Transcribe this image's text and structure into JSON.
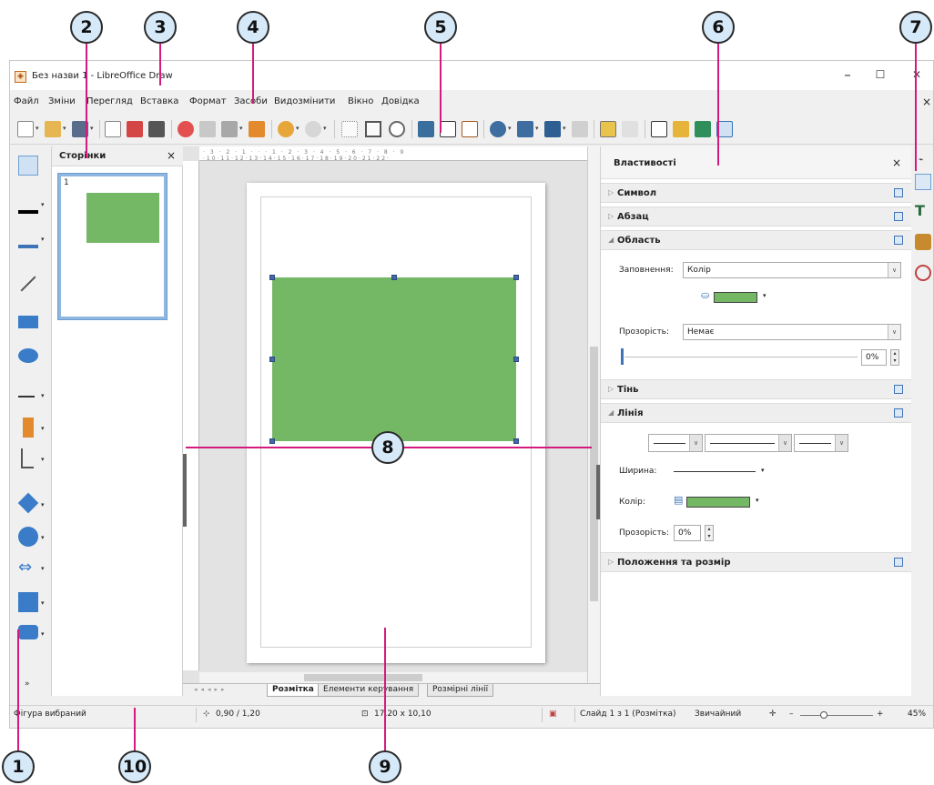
{
  "window": {
    "title": "Без назви 1 - LibreOffice Draw",
    "minimize": "–",
    "maximize": "☐",
    "close": "✕"
  },
  "menu": {
    "items": [
      "Файл",
      "Зміни",
      "Перегляд",
      "Вставка",
      "Формат",
      "Засоби",
      "Видозмінити",
      "Вікно",
      "Довідка"
    ],
    "close": "×"
  },
  "pages_panel": {
    "title": "Сторінки",
    "close": "×",
    "page_number": "1"
  },
  "properties": {
    "title": "Властивості",
    "close": "×",
    "sections": {
      "symbol": "Символ",
      "paragraph": "Абзац",
      "area": "Область",
      "shadow": "Тінь",
      "line": "Лінія",
      "position": "Положення та розмір"
    },
    "fill_label": "Заповнення:",
    "fill_value": "Колір",
    "transparency_label": "Прозорість:",
    "transparency_value": "Немає",
    "transparency_percent": "0%",
    "width_label": "Ширина:",
    "color_label": "Колір:",
    "line_transparency_label": "Прозорість:",
    "line_transparency_value": "0%"
  },
  "tabs": [
    "Розмітка",
    "Елементи керування",
    "Розмірні лінії"
  ],
  "status": {
    "selection": "Фігура вибраний",
    "position": "0,90 / 1,20",
    "size": "17,20 x 10,10",
    "slide": "Слайд 1 з 1 (Розмітка)",
    "master": "Звичайний",
    "zoom": "45%"
  },
  "callouts": [
    "1",
    "2",
    "3",
    "4",
    "5",
    "6",
    "7",
    "8",
    "9",
    "10"
  ],
  "colors": {
    "shape_fill": "#74b865",
    "callout_line": "#d6197f",
    "callout_fill": "#d6e9f9",
    "selection": "#3f73b7"
  },
  "icons": [
    "new-icon",
    "open-icon",
    "save-icon",
    "export-icon",
    "export-pdf-icon",
    "print-icon",
    "cut-icon",
    "copy-icon",
    "paste-icon",
    "clone-formatting-icon",
    "undo-icon",
    "redo-icon",
    "grid-icon",
    "helplines-icon",
    "zoom-icon",
    "image-icon",
    "textbox-icon",
    "fontwork-icon",
    "transformations-icon",
    "align-icon",
    "arrange-icon",
    "distribute-icon",
    "shadow-icon",
    "crop-icon",
    "points-icon",
    "glue-points-icon",
    "toggle-extrusion-icon",
    "display-views-icon"
  ]
}
